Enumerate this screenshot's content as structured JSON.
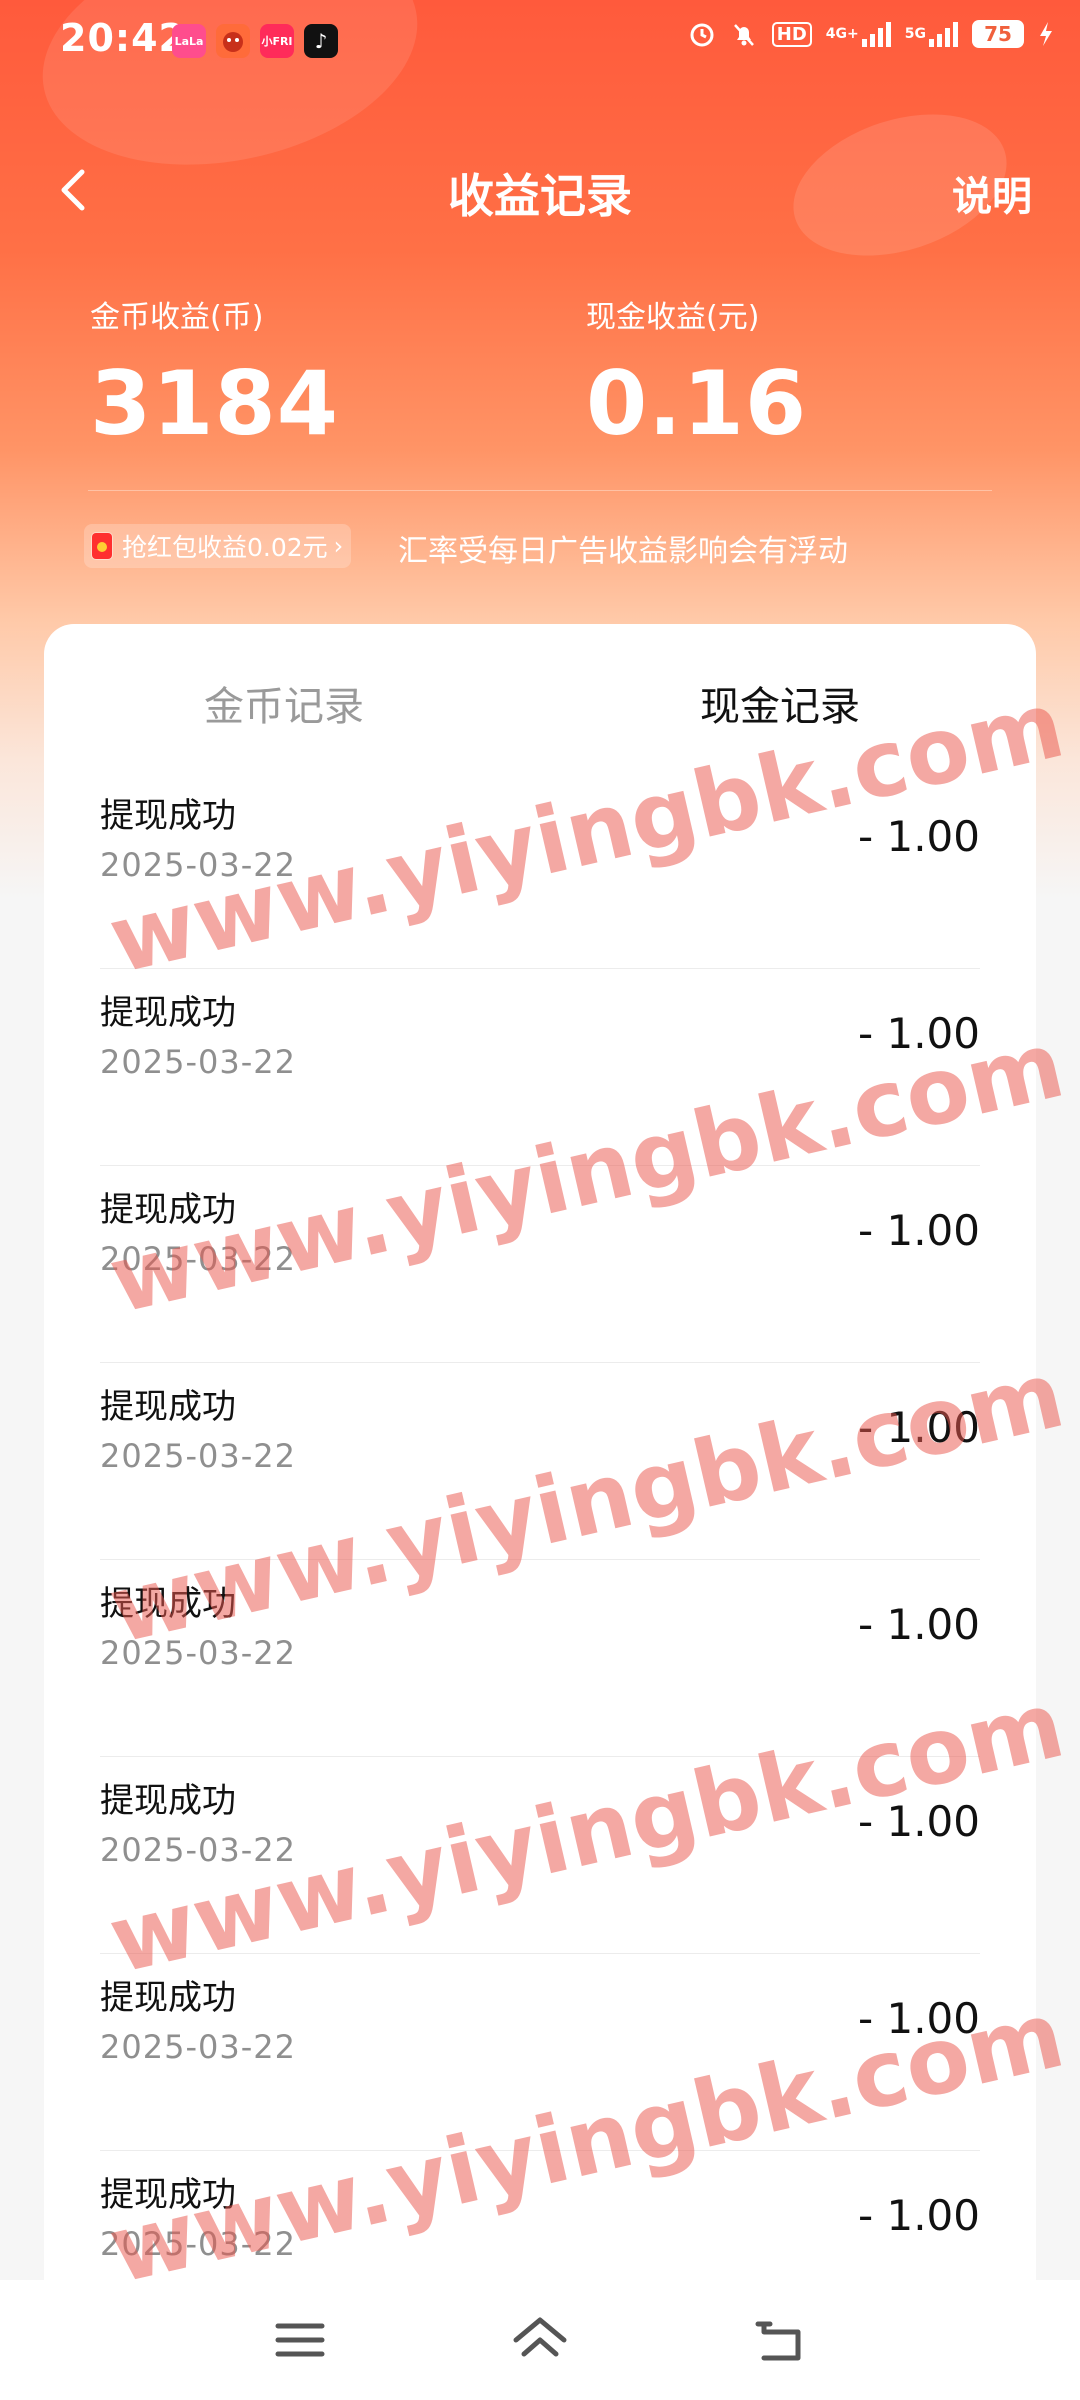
{
  "status_bar": {
    "time": "20:42",
    "app_icons": [
      {
        "name": "lala-app-icon",
        "text": "LaLa",
        "color": "#ff4d8d"
      },
      {
        "name": "character-app-icon",
        "text": "",
        "color": "#ff6b3a"
      },
      {
        "name": "mini-app-icon",
        "text": "小FRI",
        "color": "#ff2b5a"
      },
      {
        "name": "tiktok-app-icon",
        "text": "♪",
        "color": "#111111"
      }
    ],
    "hd_label": "HD",
    "net_4g": "4G+",
    "net_5g": "5G",
    "battery": "75"
  },
  "nav": {
    "title": "收益记录",
    "explain_label": "说明"
  },
  "summary": {
    "coin_label": "金币收益(币)",
    "coin_value": "3184",
    "cash_label": "现金收益(元)",
    "cash_value": "0.16",
    "red_packet_tag": "抢红包收益0.02元",
    "rate_note": "汇率受每日广告收益影响会有浮动"
  },
  "tabs": {
    "coin_label": "金币记录",
    "cash_label": "现金记录",
    "active": "cash"
  },
  "records": [
    {
      "title": "提现成功",
      "date": "2025-03-22",
      "amount": "- 1.00"
    },
    {
      "title": "提现成功",
      "date": "2025-03-22",
      "amount": "- 1.00"
    },
    {
      "title": "提现成功",
      "date": "2025-03-22",
      "amount": "- 1.00"
    },
    {
      "title": "提现成功",
      "date": "2025-03-22",
      "amount": "- 1.00"
    },
    {
      "title": "提现成功",
      "date": "2025-03-22",
      "amount": "- 1.00"
    },
    {
      "title": "提现成功",
      "date": "2025-03-22",
      "amount": "- 1.00"
    },
    {
      "title": "提现成功",
      "date": "2025-03-22",
      "amount": "- 1.00"
    },
    {
      "title": "提现成功",
      "date": "2025-03-22",
      "amount": "- 1.00"
    }
  ],
  "watermark": "www.yiyingbk.com",
  "colors": {
    "header_top": "#ff5a3c",
    "accent": "#f0603c",
    "watermark": "#ea584e"
  }
}
